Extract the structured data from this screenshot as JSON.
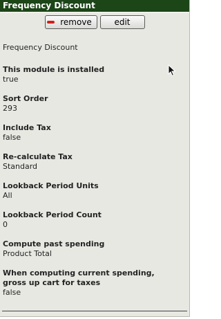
{
  "header": {
    "title": "Frequency Discount"
  },
  "buttons": {
    "remove_label": "remove",
    "edit_label": "edit"
  },
  "description": "Frequency Discount",
  "fields": [
    {
      "label": "This module is installed",
      "value": "true"
    },
    {
      "label": "Sort Order",
      "value": "293"
    },
    {
      "label": "Include Tax",
      "value": "false"
    },
    {
      "label": "Re-calculate Tax",
      "value": "Standard"
    },
    {
      "label": "Lookback Period Units",
      "value": "All"
    },
    {
      "label": "Lookback Period Count",
      "value": "0"
    },
    {
      "label": "Compute past spending",
      "value": "Product Total"
    },
    {
      "label": "When computing current spending,",
      "label_line2": "gross up cart for taxes",
      "value": "false"
    }
  ],
  "colors": {
    "header_bg": "#1c4518",
    "panel_bg": "#e8e8e3",
    "remove_icon": "#d0201a"
  },
  "icons": {
    "remove": "minus-icon",
    "pointer": "mouse-cursor-icon"
  }
}
